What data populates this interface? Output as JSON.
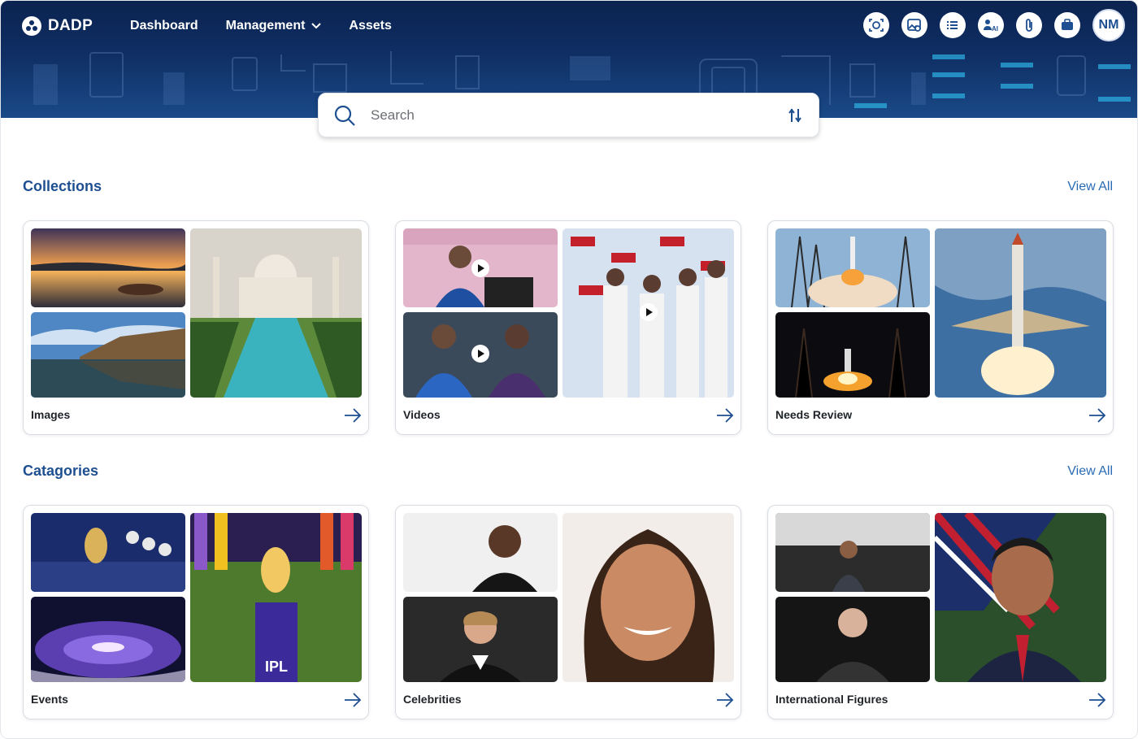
{
  "app": {
    "name": "DADP"
  },
  "nav": {
    "dashboard": "Dashboard",
    "management": "Management",
    "assets": "Assets"
  },
  "header_icons": [
    "face-scan-icon",
    "image-search-icon",
    "list-icon",
    "ai-users-icon",
    "attachment-icon",
    "briefcase-icon"
  ],
  "user": {
    "initials": "NM"
  },
  "search": {
    "placeholder": "Search"
  },
  "collections": {
    "title": "Collections",
    "view_all": "View All",
    "cards": [
      {
        "label": "Images"
      },
      {
        "label": "Videos"
      },
      {
        "label": "Needs Review"
      }
    ]
  },
  "categories": {
    "title": "Catagories",
    "view_all": "View All",
    "cards": [
      {
        "label": "Events"
      },
      {
        "label": "Celebrities"
      },
      {
        "label": "International Figures"
      }
    ]
  },
  "colors": {
    "header": "#0f2e63",
    "accent": "#1d4f91",
    "link": "#2a6bb4"
  }
}
